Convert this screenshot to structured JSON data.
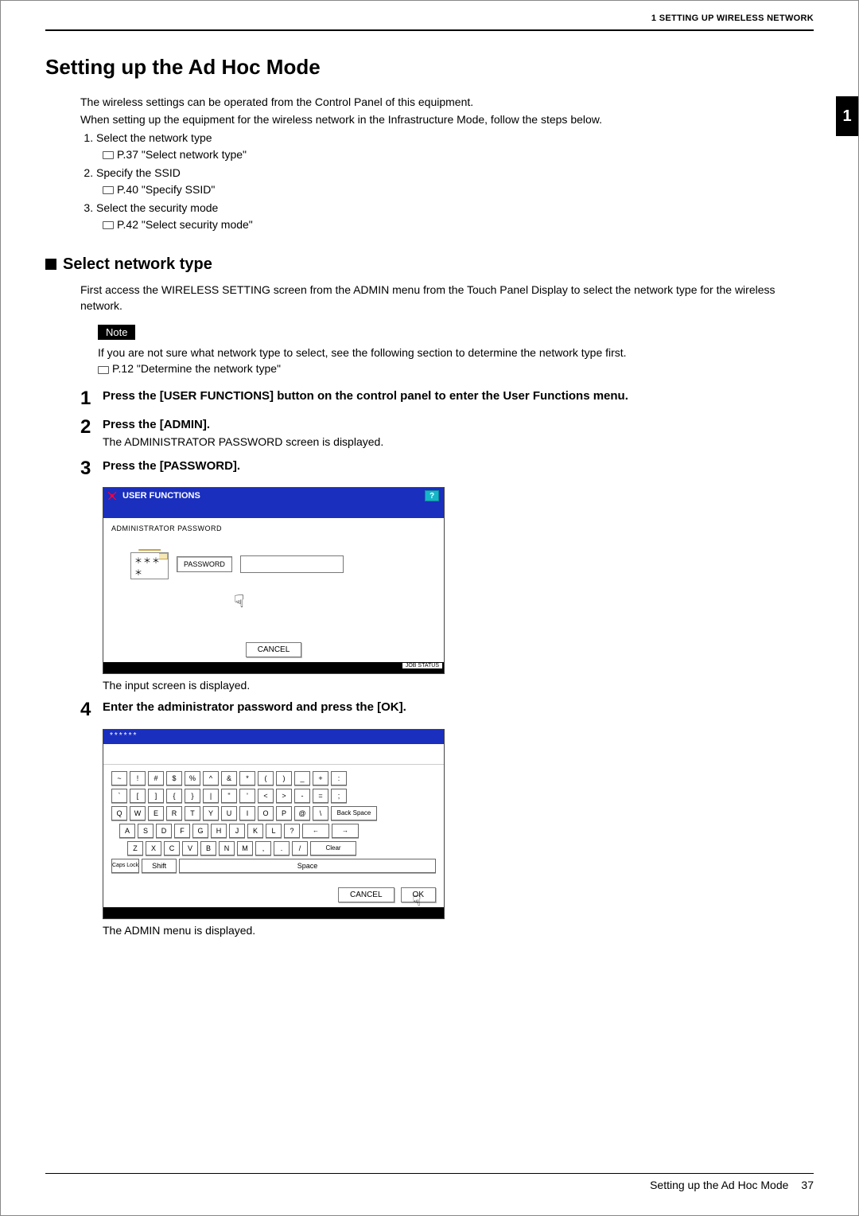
{
  "header": {
    "chapter_ref": "1 SETTING UP WIRELESS NETWORK",
    "side_tab": "1"
  },
  "title": "Setting up the Ad Hoc Mode",
  "intro": {
    "line1": "The wireless settings can be operated from the Control Panel of this equipment.",
    "line2": "When setting up the equipment for the wireless network in the Infrastructure Mode, follow the steps below."
  },
  "toc": [
    {
      "label": "Select the network type",
      "ref": "P.37 \"Select network type\""
    },
    {
      "label": "Specify the SSID",
      "ref": "P.40 \"Specify SSID\""
    },
    {
      "label": "Select the security mode",
      "ref": "P.42 \"Select security mode\""
    }
  ],
  "section": {
    "heading": "Select network type",
    "body": "First access the WIRELESS SETTING screen from the ADMIN menu from the Touch Panel Display to select the network type for the wireless network."
  },
  "note": {
    "label": "Note",
    "body": "If you are not sure what network type to select, see the following section to determine the network type first.",
    "ref": "P.12 \"Determine the network type\""
  },
  "steps": [
    {
      "n": "1",
      "title": "Press the [USER FUNCTIONS] button on the control panel to enter the User Functions menu."
    },
    {
      "n": "2",
      "title": "Press the [ADMIN].",
      "sub": "The ADMINISTRATOR PASSWORD screen is displayed."
    },
    {
      "n": "3",
      "title": "Press the [PASSWORD].",
      "caption": "The input screen is displayed."
    },
    {
      "n": "4",
      "title": "Enter the administrator password and press the [OK].",
      "caption": "The ADMIN menu is displayed."
    }
  ],
  "screenshot1": {
    "title": "USER FUNCTIONS",
    "help": "?",
    "subtitle": "ADMINISTRATOR PASSWORD",
    "stars": "＊＊＊＊",
    "pw_button": "PASSWORD",
    "cancel": "CANCEL",
    "jobstatus": "JOB STATUS"
  },
  "screenshot2": {
    "mask": "******",
    "rows": {
      "r1": [
        "~",
        "!",
        "#",
        "$",
        "%",
        "^",
        "&",
        "*",
        "(",
        ")",
        "_",
        "+",
        ":"
      ],
      "r2": [
        "`",
        "[",
        "]",
        "{",
        "}",
        "|",
        "\"",
        "'",
        "<",
        ">",
        "-",
        "=",
        ";"
      ],
      "r3": [
        "Q",
        "W",
        "E",
        "R",
        "T",
        "Y",
        "U",
        "I",
        "O",
        "P",
        "@",
        "\\"
      ],
      "r4": [
        "A",
        "S",
        "D",
        "F",
        "G",
        "H",
        "J",
        "K",
        "L",
        "?"
      ],
      "r5": [
        "Z",
        "X",
        "C",
        "V",
        "B",
        "N",
        "M",
        ",",
        ".",
        "/"
      ]
    },
    "backspace": "Back Space",
    "arrow_left": "←",
    "arrow_right": "→",
    "clear": "Clear",
    "caps": "Caps Lock",
    "shift": "Shift",
    "space": "Space",
    "cancel": "CANCEL",
    "ok": "OK"
  },
  "footer": {
    "label": "Setting up the Ad Hoc Mode",
    "page": "37"
  }
}
